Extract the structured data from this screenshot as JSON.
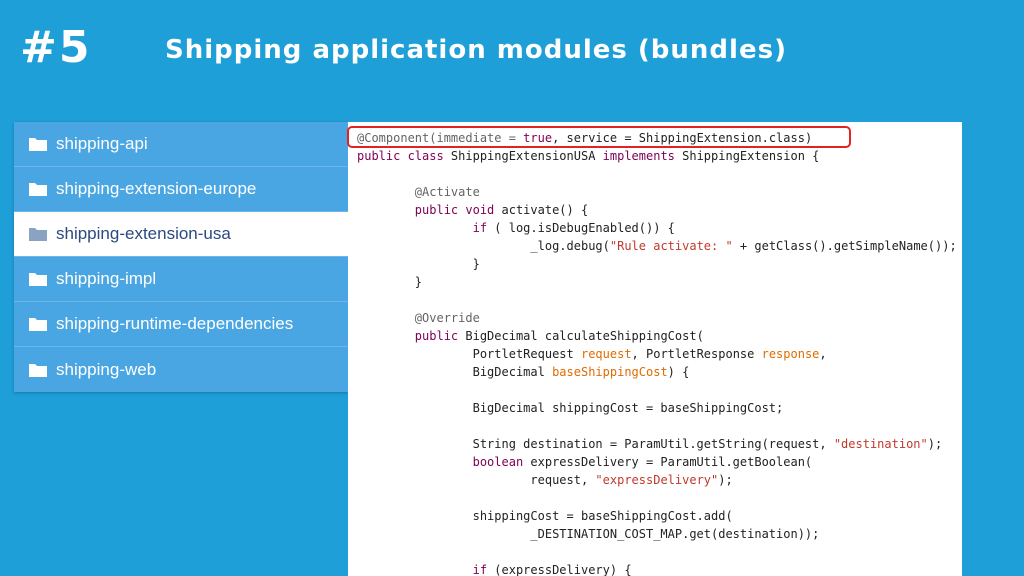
{
  "slide": {
    "number": "#5",
    "title": "Shipping application modules (bundles)"
  },
  "colors": {
    "background": "#1e9fd8",
    "list_background": "#4aa6e2",
    "highlight_border": "#e02424",
    "keyword": "#7f0055",
    "string": "#c0392b",
    "parameter": "#e06c00"
  },
  "modules": {
    "items": [
      {
        "label": "shipping-api",
        "icon": "folder-icon",
        "selected": false
      },
      {
        "label": "shipping-extension-europe",
        "icon": "folder-icon",
        "selected": false
      },
      {
        "label": "shipping-extension-usa",
        "icon": "folder-icon",
        "selected": true
      },
      {
        "label": "shipping-impl",
        "icon": "folder-icon",
        "selected": false
      },
      {
        "label": "shipping-runtime-dependencies",
        "icon": "folder-icon",
        "selected": false
      },
      {
        "label": "shipping-web",
        "icon": "folder-icon",
        "selected": false
      }
    ]
  },
  "code": {
    "highlighted_line": 0,
    "lines": [
      [
        {
          "t": "@Component(immediate = ",
          "c": "ann"
        },
        {
          "t": "true",
          "c": "kw"
        },
        {
          "t": ", service = ShippingExtension.class)",
          "c": ""
        }
      ],
      [
        {
          "t": "public class ",
          "c": "kw"
        },
        {
          "t": "ShippingExtensionUSA ",
          "c": ""
        },
        {
          "t": "implements ",
          "c": "kw"
        },
        {
          "t": "ShippingExtension {",
          "c": ""
        }
      ],
      [],
      [
        {
          "t": "        @Activate",
          "c": "ann"
        }
      ],
      [
        {
          "t": "        public void ",
          "c": "kw"
        },
        {
          "t": "activate() {",
          "c": ""
        }
      ],
      [
        {
          "t": "                if ",
          "c": "kw"
        },
        {
          "t": "( log.isDebugEnabled()) {",
          "c": ""
        }
      ],
      [
        {
          "t": "                        _log.debug(",
          "c": ""
        },
        {
          "t": "\"Rule activate: \"",
          "c": "str"
        },
        {
          "t": " + getClass().getSimpleName());",
          "c": ""
        }
      ],
      [
        {
          "t": "                }",
          "c": ""
        }
      ],
      [
        {
          "t": "        }",
          "c": ""
        }
      ],
      [],
      [
        {
          "t": "        @Override",
          "c": "ann"
        }
      ],
      [
        {
          "t": "        public ",
          "c": "kw"
        },
        {
          "t": "BigDecimal calculateShippingCost(",
          "c": ""
        }
      ],
      [
        {
          "t": "                PortletRequest ",
          "c": ""
        },
        {
          "t": "request",
          "c": "param"
        },
        {
          "t": ", PortletResponse ",
          "c": ""
        },
        {
          "t": "response",
          "c": "param"
        },
        {
          "t": ",",
          "c": ""
        }
      ],
      [
        {
          "t": "                BigDecimal ",
          "c": ""
        },
        {
          "t": "baseShippingCost",
          "c": "param"
        },
        {
          "t": ") {",
          "c": ""
        }
      ],
      [],
      [
        {
          "t": "                BigDecimal shippingCost = baseShippingCost;",
          "c": ""
        }
      ],
      [],
      [
        {
          "t": "                String destination = ParamUtil.getString(request, ",
          "c": ""
        },
        {
          "t": "\"destination\"",
          "c": "str"
        },
        {
          "t": ");",
          "c": ""
        }
      ],
      [
        {
          "t": "                boolean ",
          "c": "kw"
        },
        {
          "t": "expressDelivery = ParamUtil.getBoolean(",
          "c": ""
        }
      ],
      [
        {
          "t": "                        request, ",
          "c": ""
        },
        {
          "t": "\"expressDelivery\"",
          "c": "str"
        },
        {
          "t": ");",
          "c": ""
        }
      ],
      [],
      [
        {
          "t": "                shippingCost = baseShippingCost.add(",
          "c": ""
        }
      ],
      [
        {
          "t": "                        _DESTINATION_COST_MAP.get(destination));",
          "c": ""
        }
      ],
      [],
      [
        {
          "t": "                if ",
          "c": "kw"
        },
        {
          "t": "(expressDelivery) {",
          "c": ""
        }
      ]
    ]
  }
}
